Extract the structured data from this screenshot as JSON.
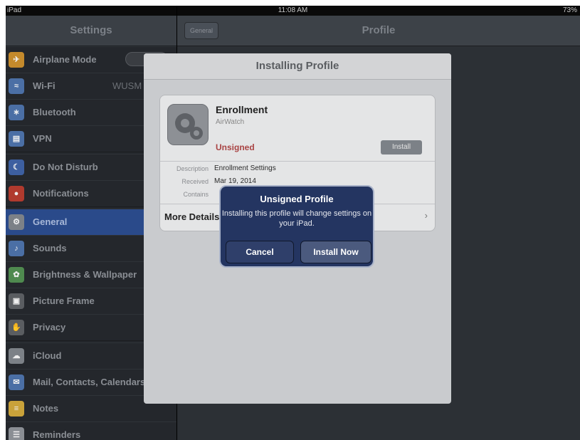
{
  "status_bar": {
    "device": "iPad",
    "time": "11:08 AM",
    "battery": "73%"
  },
  "sidebar": {
    "title": "Settings",
    "groups": [
      [
        {
          "label": "Airplane Mode",
          "toggle": "OFF",
          "icon": "airplane-icon",
          "color": "#c48a2c"
        },
        {
          "label": "Wi-Fi",
          "value": "WUSM",
          "icon": "wifi-icon",
          "color": "#4b6fa5"
        },
        {
          "label": "Bluetooth",
          "icon": "bluetooth-icon",
          "color": "#4b6fa5"
        },
        {
          "label": "VPN",
          "icon": "vpn-icon",
          "color": "#4b6fa5"
        }
      ],
      [
        {
          "label": "Do Not Disturb",
          "icon": "moon-icon",
          "color": "#3d5fa0"
        },
        {
          "label": "Notifications",
          "icon": "notifications-icon",
          "color": "#b03a2e"
        }
      ],
      [
        {
          "label": "General",
          "icon": "gear-icon",
          "color": "#7c8187",
          "selected": true
        },
        {
          "label": "Sounds",
          "icon": "speaker-icon",
          "color": "#4b6fa5"
        },
        {
          "label": "Brightness & Wallpaper",
          "icon": "flower-icon",
          "color": "#4f8a4f"
        },
        {
          "label": "Picture Frame",
          "icon": "picture-frame-icon",
          "color": "#5a5d61"
        },
        {
          "label": "Privacy",
          "icon": "hand-icon",
          "color": "#5a5d61"
        }
      ],
      [
        {
          "label": "iCloud",
          "icon": "cloud-icon",
          "color": "#7c8187"
        },
        {
          "label": "Mail, Contacts, Calendars",
          "icon": "mail-icon",
          "color": "#4b6fa5"
        },
        {
          "label": "Notes",
          "icon": "notes-icon",
          "color": "#c9a23a"
        },
        {
          "label": "Reminders",
          "icon": "reminders-icon",
          "color": "#8a8e94"
        }
      ]
    ]
  },
  "detail": {
    "back_label": "General",
    "title": "Profile"
  },
  "modal": {
    "title": "Installing Profile",
    "profile_name": "Enrollment",
    "profile_org": "AirWatch",
    "signed_status": "Unsigned",
    "install_label": "Install",
    "fields": [
      {
        "key": "Description",
        "value": "Enrollment Settings"
      },
      {
        "key": "Received",
        "value": "Mar 19, 2014"
      },
      {
        "key": "Contains",
        "value": ""
      }
    ],
    "more_details": "More Details"
  },
  "alert": {
    "title": "Unsigned Profile",
    "message": "Installing this profile will change settings on your iPad.",
    "cancel_label": "Cancel",
    "confirm_label": "Install Now"
  }
}
